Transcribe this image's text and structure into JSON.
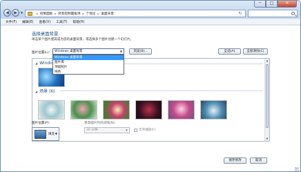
{
  "window": {
    "minimize_glyph": "─",
    "maximize_glyph": "□",
    "close_glyph": "✕"
  },
  "address": {
    "crumbs": [
      "控制面板",
      "所有控制面板项",
      "个性化",
      "桌面背景"
    ],
    "separator": "▸",
    "refresh_glyph": "↻"
  },
  "menu": [
    "文件(F)",
    "编辑(E)",
    "查看(V)",
    "工具(T)",
    "帮助(H)"
  ],
  "page": {
    "heading": "选择桌面背景",
    "description": "单击某个图片使其成为您的桌面背景，或选择多个图片创建一个幻灯片。"
  },
  "picture_location": {
    "label": "图片位置(L):",
    "value": "Windows 桌面背景",
    "options": [
      "Windows 桌面背景",
      "图片库",
      "顶级照片",
      "纯色"
    ],
    "selected_index": 0
  },
  "buttons": {
    "browse": "浏览(B)...",
    "select_all": "全选(A)",
    "clear_all": "全部清除(C)",
    "save": "保存修改",
    "cancel": "取消"
  },
  "groups": [
    {
      "title": "Windows (1)"
    },
    {
      "title": "场景 (6)"
    }
  ],
  "picture_position": {
    "label": "图片位置(P):",
    "value": "填充"
  },
  "interval": {
    "label": "更改图片时间间隔(N):",
    "value": "30 分钟"
  },
  "shuffle": {
    "label": "无序播放(F)",
    "checked": false
  },
  "icons": {
    "back": "back-arrow-icon",
    "forward": "forward-arrow-icon",
    "folder": "folder-icon",
    "search": "search-icon",
    "refresh": "refresh-icon"
  },
  "colors": {
    "accent": "#1b4f8a",
    "selection": "#3399ff",
    "frame": "#cfe0f3"
  }
}
